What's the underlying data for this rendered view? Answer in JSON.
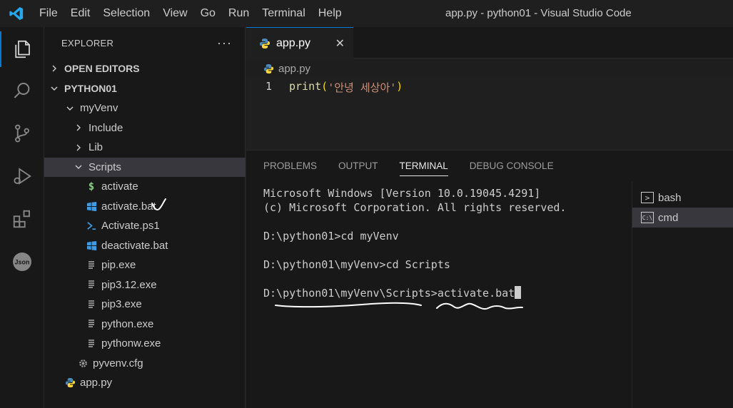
{
  "window_title": "app.py - python01 - Visual Studio Code",
  "menu": [
    "File",
    "Edit",
    "Selection",
    "View",
    "Go",
    "Run",
    "Terminal",
    "Help"
  ],
  "explorer": {
    "title": "EXPLORER",
    "more": "···",
    "open_editors": "OPEN EDITORS",
    "project": "PYTHON01",
    "tree": [
      {
        "label": "myVenv",
        "kind": "folder-open",
        "depth": 1
      },
      {
        "label": "Include",
        "kind": "folder-closed",
        "depth": 2
      },
      {
        "label": "Lib",
        "kind": "folder-closed",
        "depth": 2
      },
      {
        "label": "Scripts",
        "kind": "folder-open",
        "depth": 2
      },
      {
        "label": "activate",
        "kind": "shell",
        "depth": 3
      },
      {
        "label": "activate.bat",
        "kind": "windows",
        "depth": 3
      },
      {
        "label": "Activate.ps1",
        "kind": "powershell",
        "depth": 3
      },
      {
        "label": "deactivate.bat",
        "kind": "windows",
        "depth": 3
      },
      {
        "label": "pip.exe",
        "kind": "file",
        "depth": 3
      },
      {
        "label": "pip3.12.exe",
        "kind": "file",
        "depth": 3
      },
      {
        "label": "pip3.exe",
        "kind": "file",
        "depth": 3
      },
      {
        "label": "python.exe",
        "kind": "file",
        "depth": 3
      },
      {
        "label": "pythonw.exe",
        "kind": "file",
        "depth": 3
      },
      {
        "label": "pyvenv.cfg",
        "kind": "gear",
        "depth": 2
      },
      {
        "label": "app.py",
        "kind": "python",
        "depth": 1
      }
    ]
  },
  "editor": {
    "tab_label": "app.py",
    "breadcrumb": "app.py",
    "line_number": "1",
    "code": {
      "fn": "print",
      "open": "(",
      "str": "'안녕 세상아'",
      "close": ")"
    }
  },
  "panel": {
    "tabs": [
      "PROBLEMS",
      "OUTPUT",
      "TERMINAL",
      "DEBUG CONSOLE"
    ],
    "active_tab": "TERMINAL",
    "terminal_lines": [
      "Microsoft Windows [Version 10.0.19045.4291]",
      "(c) Microsoft Corporation. All rights reserved.",
      "",
      "D:\\python01>cd myVenv",
      "",
      "D:\\python01\\myVenv>cd Scripts",
      "",
      "D:\\python01\\myVenv\\Scripts>activate.bat"
    ],
    "terminals": [
      {
        "label": "bash",
        "icon": ">"
      },
      {
        "label": "cmd",
        "icon": "C:\\"
      }
    ]
  },
  "colors": {
    "accent": "#0078d4",
    "annotation": "#ffffff"
  }
}
